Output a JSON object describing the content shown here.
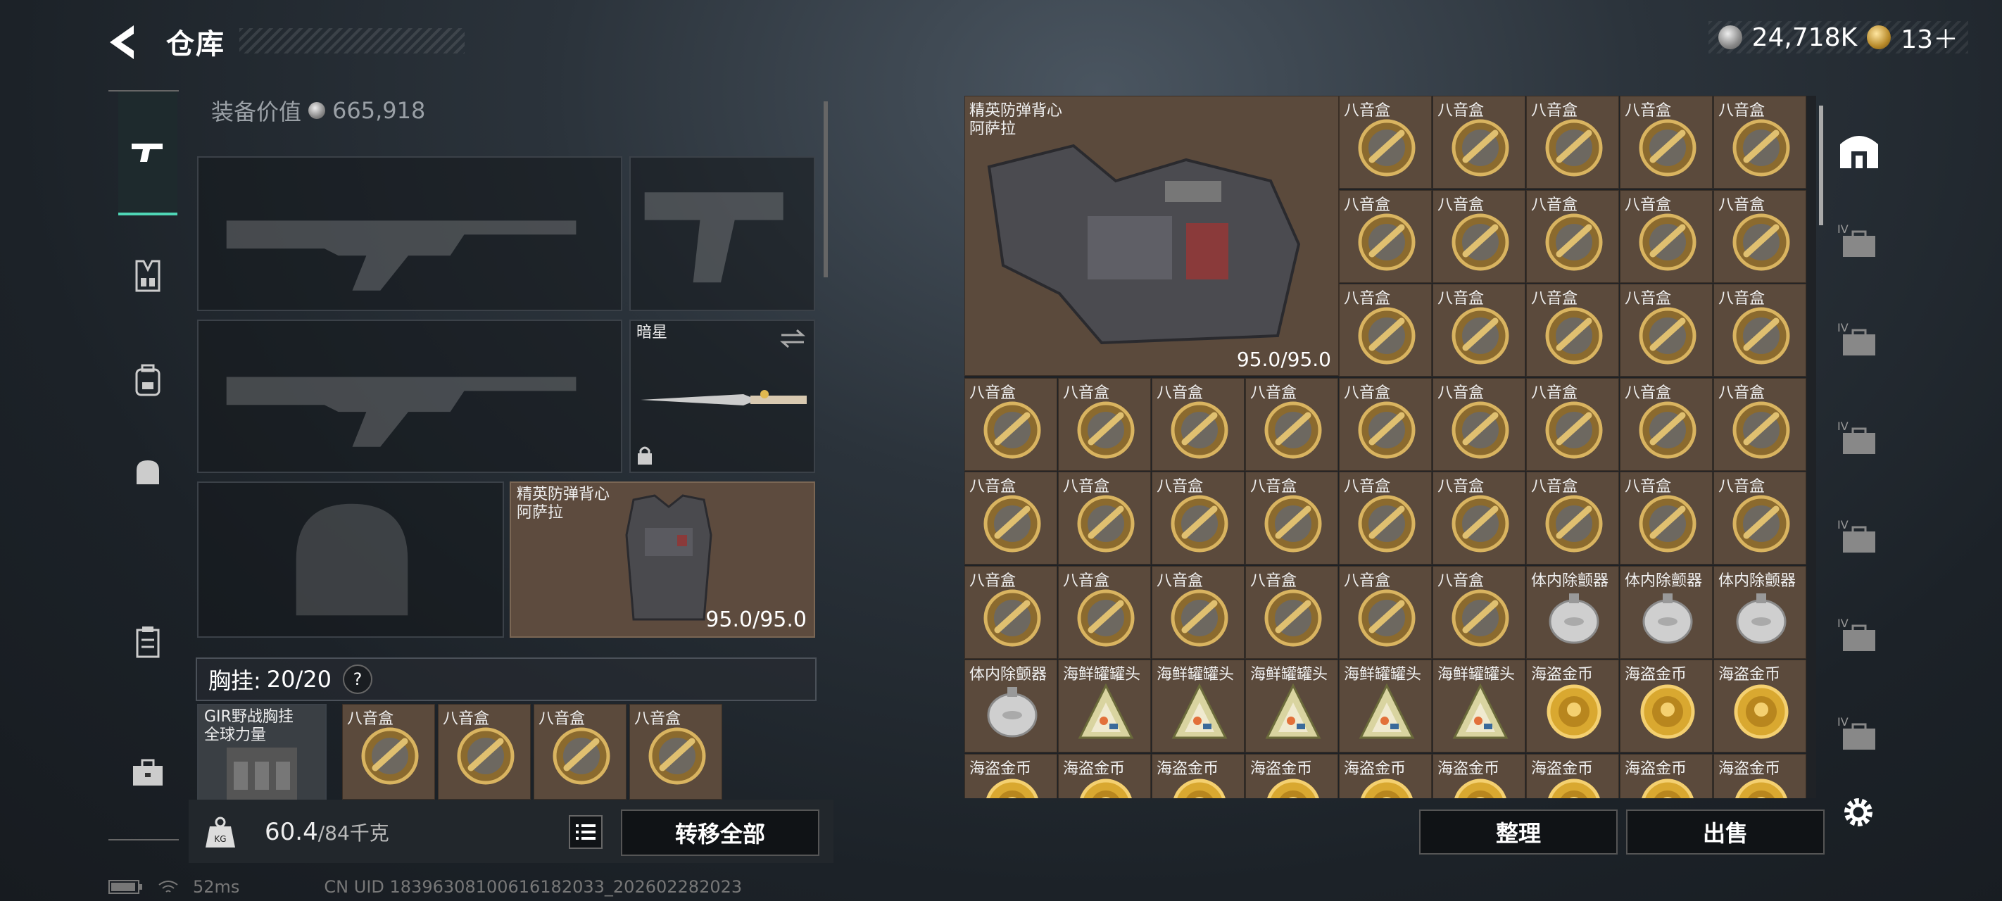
{
  "header": {
    "title": "仓库"
  },
  "currency": {
    "silver": "24,718K",
    "gold": "13＋"
  },
  "equipment": {
    "value_label": "装备价值",
    "value": "665,918",
    "melee": {
      "name": "暗星"
    },
    "armor": {
      "name_line1": "精英防弹背心",
      "name_line2": "阿萨拉",
      "durability": "95.0/95.0"
    },
    "chest_rig": {
      "label": "胸挂:",
      "count": "20/20",
      "help": "?",
      "name_line1": "GIR野战胸挂",
      "name_line2": "全球力量",
      "items": [
        "八音盒",
        "八音盒",
        "八音盒",
        "八音盒"
      ]
    }
  },
  "weight": {
    "current": "60.4",
    "max": "/84千克",
    "icon_label": "KG"
  },
  "buttons": {
    "transfer_all": "转移全部",
    "sort": "整理",
    "sell": "出售"
  },
  "status": {
    "ping": "52ms",
    "uid": "CN UID 1839630810061618203​3_202602282023"
  },
  "storage": {
    "armor": {
      "name_line1": "精英防弹背心",
      "name_line2": "阿萨拉",
      "durability": "95.0/95.0"
    },
    "rows": [
      [
        "八音盒",
        "八音盒",
        "八音盒",
        "八音盒",
        "八音盒"
      ],
      [
        "八音盒",
        "八音盒",
        "八音盒",
        "八音盒",
        "八音盒"
      ],
      [
        "八音盒",
        "八音盒",
        "八音盒",
        "八音盒",
        "八音盒"
      ],
      [
        "八音盒",
        "八音盒",
        "八音盒",
        "八音盒",
        "八音盒",
        "八音盒",
        "八音盒",
        "八音盒",
        "八音盒"
      ],
      [
        "八音盒",
        "八音盒",
        "八音盒",
        "八音盒",
        "八音盒",
        "八音盒",
        "八音盒",
        "八音盒",
        "八音盒"
      ],
      [
        "八音盒",
        "八音盒",
        "八音盒",
        "八音盒",
        "八音盒",
        "八音盒",
        "体内除颤器",
        "体内除颤器",
        "体内除颤器"
      ],
      [
        "体内除颤器",
        "海鲜罐罐头",
        "海鲜罐罐头",
        "海鲜罐罐头",
        "海鲜罐罐头",
        "海鲜罐罐头",
        "海盗金币",
        "海盗金币",
        "海盗金币"
      ],
      [
        "海盗金币",
        "海盗金币",
        "海盗金币",
        "海盗金币",
        "海盗金币",
        "海盗金币",
        "海盗金币",
        "海盗金币",
        "海盗金币"
      ]
    ]
  },
  "icons": {
    "music_box": "music-box-icon",
    "defibrillator": "defibrillator-icon",
    "canned_seafood": "canned-seafood-icon",
    "pirate_coin": "pirate-coin-icon"
  },
  "right_rail": {
    "tier_labels": [
      "IV",
      "IV",
      "IV",
      "IV",
      "IV",
      "IV"
    ]
  }
}
